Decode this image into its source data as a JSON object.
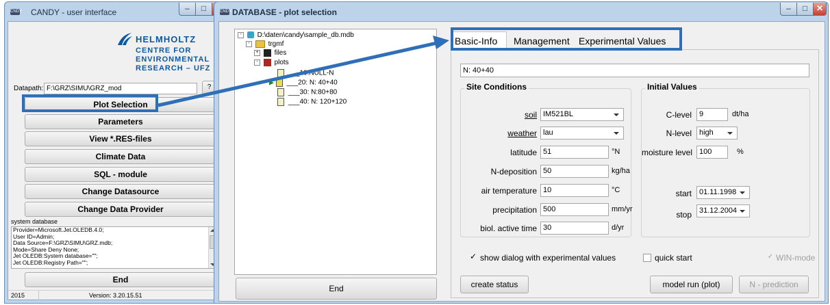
{
  "left_window": {
    "title": "CANDY - user interface",
    "logo": {
      "brand": "HELMHOLTZ",
      "line1": "CENTRE FOR",
      "line2": "ENVIRONMENTAL",
      "line3": "RESEARCH – UFZ"
    },
    "datapath_label": "Datapath:",
    "datapath_value": "F:\\GRZ\\SIMU\\GRZ_mod",
    "datapath_btn": "?",
    "buttons": {
      "plot_selection": "Plot Selection",
      "parameters": "Parameters",
      "view_res": "View *.RES-files",
      "climate": "Climate Data",
      "sql": "SQL - module",
      "change_datasource": "Change Datasource",
      "change_provider": "Change Data Provider",
      "end": "End"
    },
    "system_db_label": "system database",
    "connection_lines": [
      "Provider=Microsoft.Jet.OLEDB.4.0;",
      "User ID=Admin;",
      "Data Source=F:\\GRZ\\SIMU\\GRZ.mdb;",
      "Mode=Share Deny None;",
      "Jet OLEDB:System database=\"\";",
      "Jet OLEDB:Registry Path=\"\";"
    ],
    "status_left": "2015",
    "status_version": "Version: 3.20.15.51"
  },
  "right_window": {
    "title": "DATABASE - plot selection",
    "tree": {
      "root": "D:\\daten\\candy\\sample_db.mdb",
      "group": "trgmf",
      "files": "files",
      "plots": "plots",
      "items": [
        "___10:NULL-N",
        "___20: N: 40+40",
        "___30: N:80+80",
        "___40: N: 120+120"
      ]
    },
    "end_button": "End",
    "tabs": [
      "Basic-Info",
      "Management",
      "Experimental Values"
    ],
    "plot_name": "N: 40+40",
    "site": {
      "title": "Site Conditions",
      "soil_label": "soil",
      "soil_value": "IM521BL",
      "weather_label": "weather",
      "weather_value": "lau",
      "latitude_label": "latitude",
      "latitude_value": "51",
      "latitude_unit": "°N",
      "ndep_label": "N-deposition",
      "ndep_value": "50",
      "ndep_unit": "kg/ha",
      "airtemp_label": "air temperature",
      "airtemp_value": "10",
      "airtemp_unit": "°C",
      "precip_label": "precipitation",
      "precip_value": "500",
      "precip_unit": "mm/yr",
      "bat_label": "biol. active time",
      "bat_value": "30",
      "bat_unit": "d/yr"
    },
    "initial": {
      "title": "Initial Values",
      "clevel_label": "C-level",
      "clevel_value": "9",
      "clevel_unit": "dt/ha",
      "nlevel_label": "N-level",
      "nlevel_value": "high",
      "moist_label": "moisture level",
      "moist_value": "100",
      "moist_unit": "%",
      "start_label": "start",
      "start_value": "01.11.1998",
      "stop_label": "stop",
      "stop_value": "31.12.2004"
    },
    "checks": {
      "show_dialog": "show dialog with experimental values",
      "quick_start": "quick start",
      "win_mode": "WIN-mode"
    },
    "bottom_buttons": {
      "create_status": "create status",
      "model_run": "model run (plot)",
      "n_prediction": "N - prediction"
    }
  },
  "colors": {
    "highlight": "#2f6fb8",
    "window_frame": "#bcd3ea",
    "close": "#c5412f"
  }
}
